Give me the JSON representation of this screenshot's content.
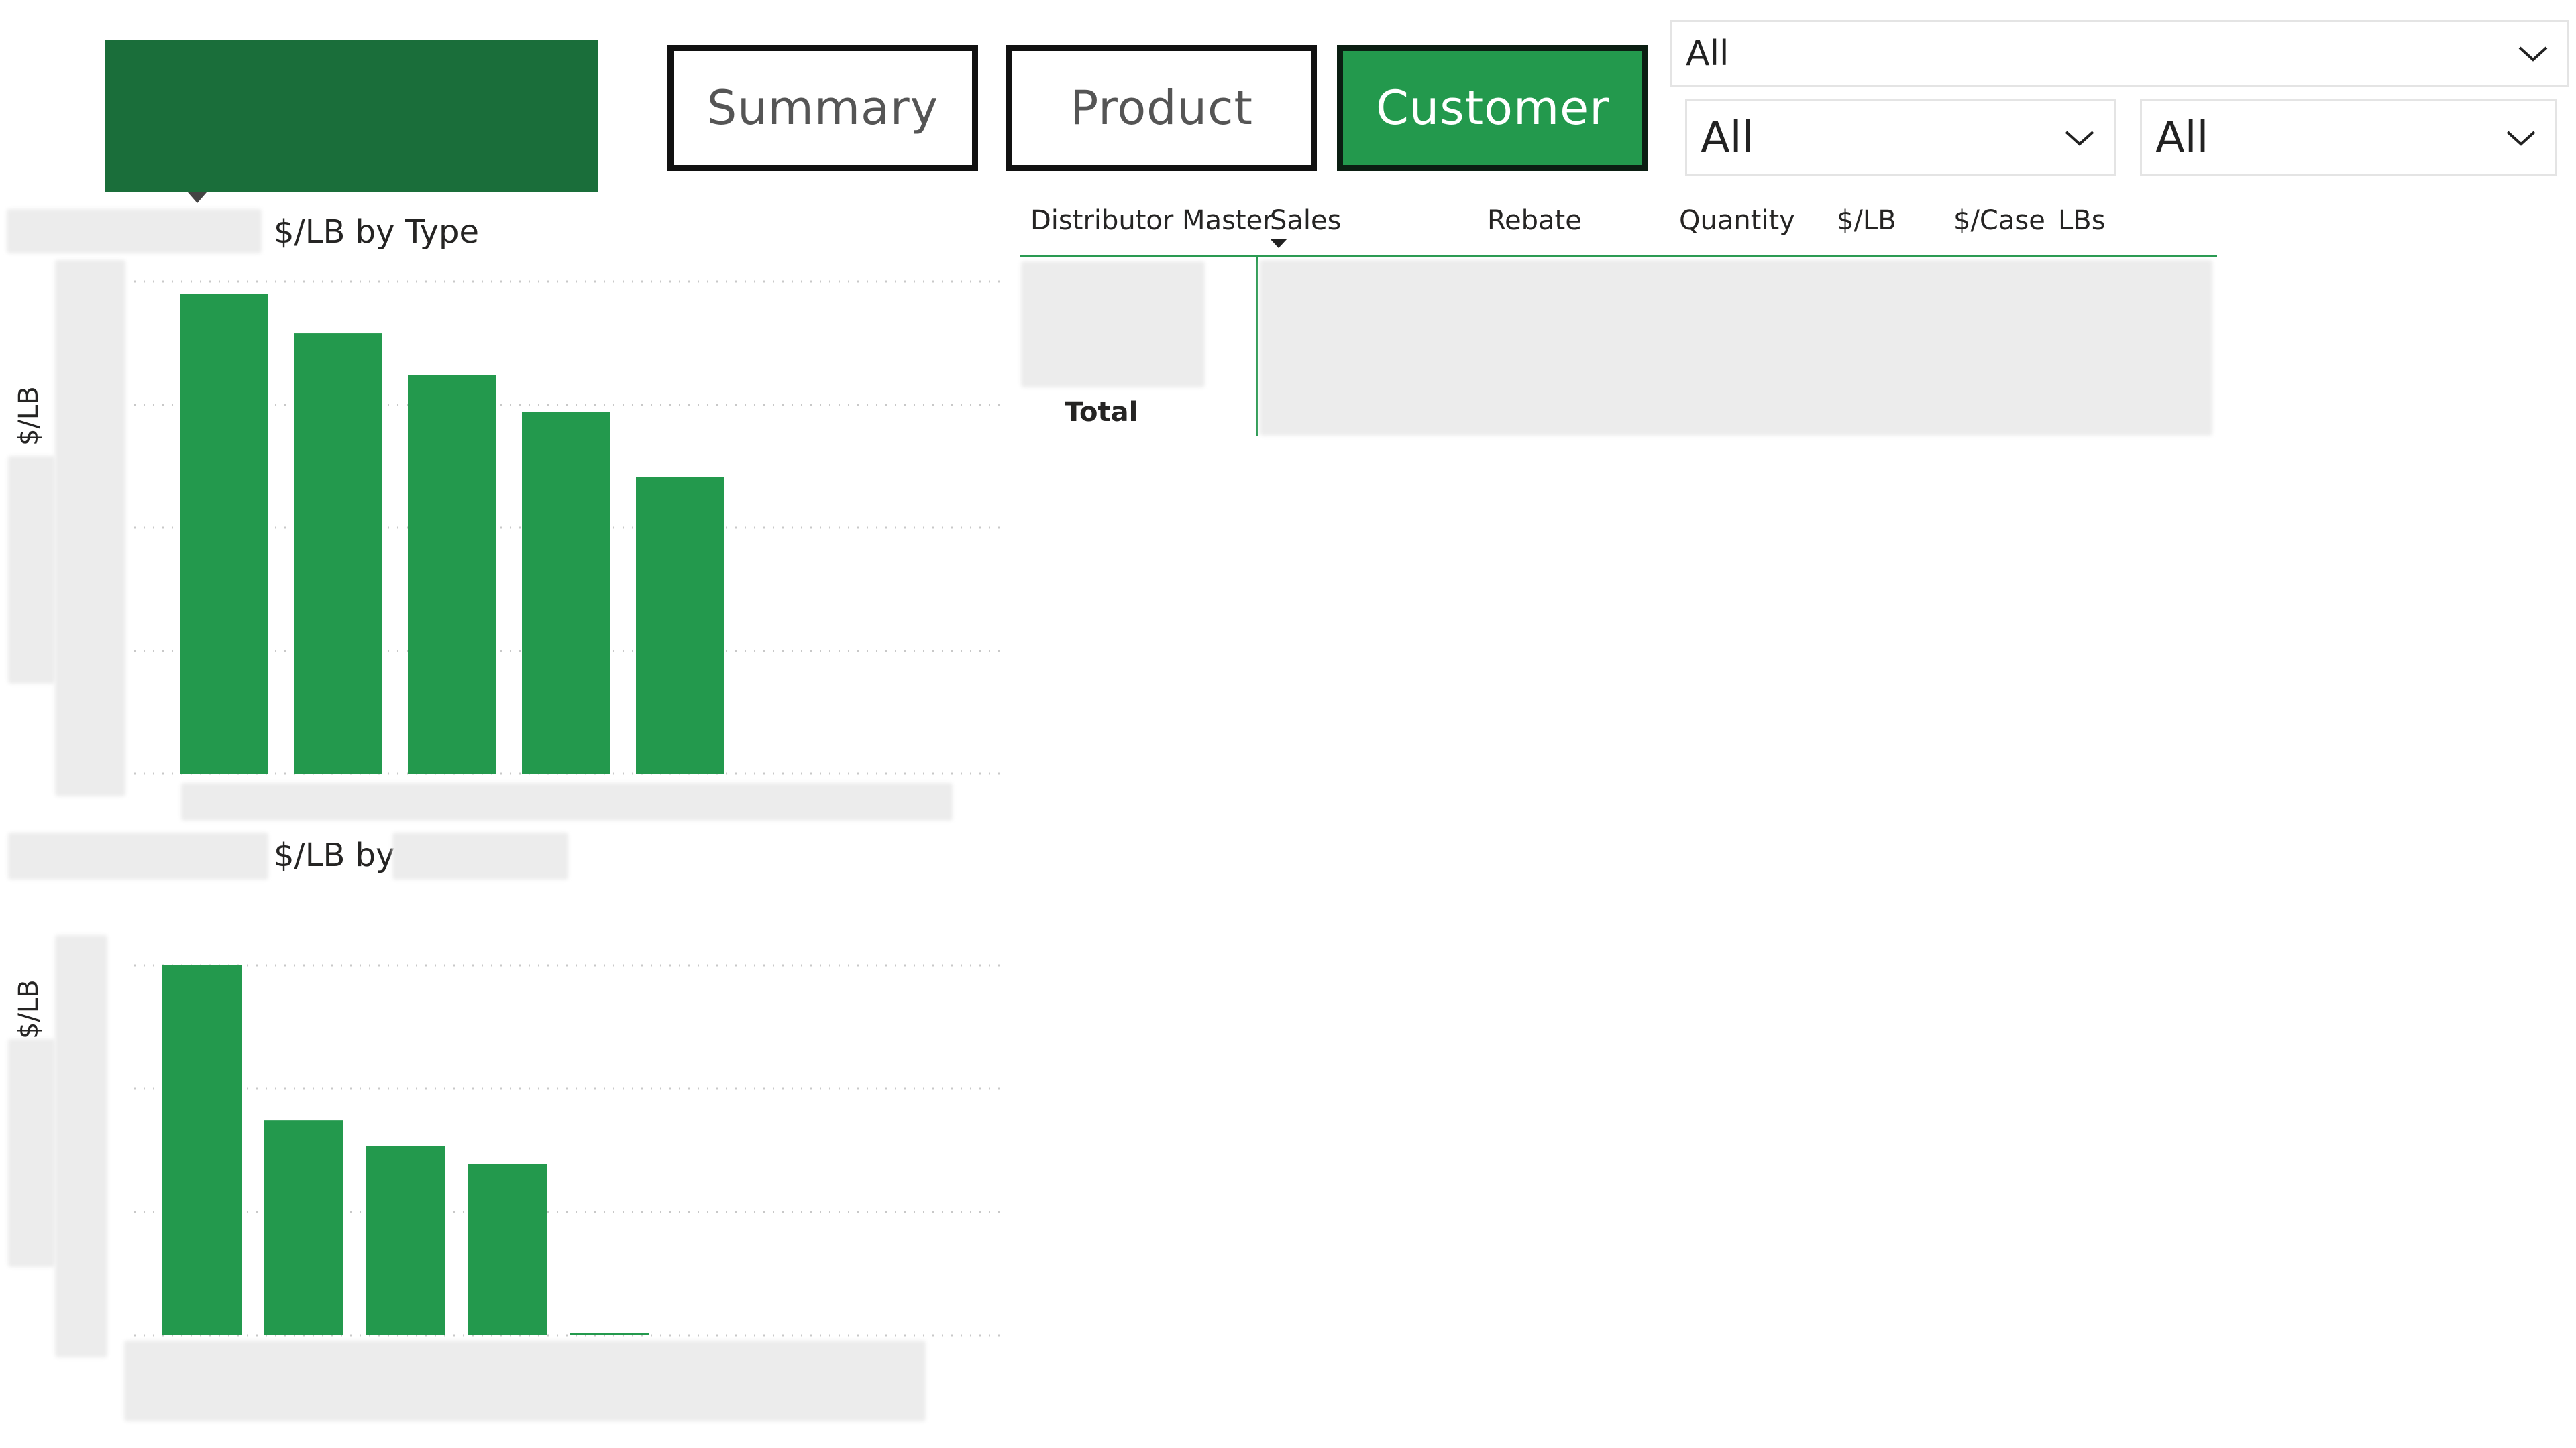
{
  "header": {
    "nav": [
      {
        "label": "Summary",
        "active": false
      },
      {
        "label": "Product",
        "active": false
      },
      {
        "label": "Customer",
        "active": true
      }
    ],
    "filters": {
      "top": "All",
      "bottom_left": "All",
      "bottom_right": "All"
    }
  },
  "colors": {
    "brand_dark_green": "#1a6e3a",
    "accent_green": "#23994d",
    "selected_border": "#0b1e12"
  },
  "icons": [
    "chevron-down-icon",
    "sort-down-icon"
  ],
  "chart_top": {
    "title": "$/LB by Type",
    "ylabel": "$/LB"
  },
  "chart_bottom": {
    "title": "$/LB by",
    "ylabel": "$/LB"
  },
  "chart_data": [
    {
      "type": "bar",
      "title": "$/LB by Type",
      "ylabel": "$/LB",
      "categories": [
        "",
        "",
        "",
        "",
        ""
      ],
      "values": [
        3.9,
        3.58,
        3.24,
        2.94,
        2.41
      ],
      "ylim": [
        0,
        4
      ],
      "grid": true,
      "color": "#23994d"
    },
    {
      "type": "bar",
      "title": "$/LB by",
      "ylabel": "$/LB",
      "categories": [
        "",
        "",
        "",
        "",
        ""
      ],
      "values": [
        3.2,
        1.86,
        1.64,
        1.48,
        0.02
      ],
      "ylim": [
        0,
        3.2
      ],
      "grid": true,
      "color": "#23994d"
    }
  ],
  "table": {
    "columns": [
      "Distributor Master",
      "Sales",
      "Rebate",
      "Quantity",
      "$/LB",
      "$/Case",
      "LBs"
    ],
    "sorted_column": "Sales",
    "total_label": "Total"
  }
}
